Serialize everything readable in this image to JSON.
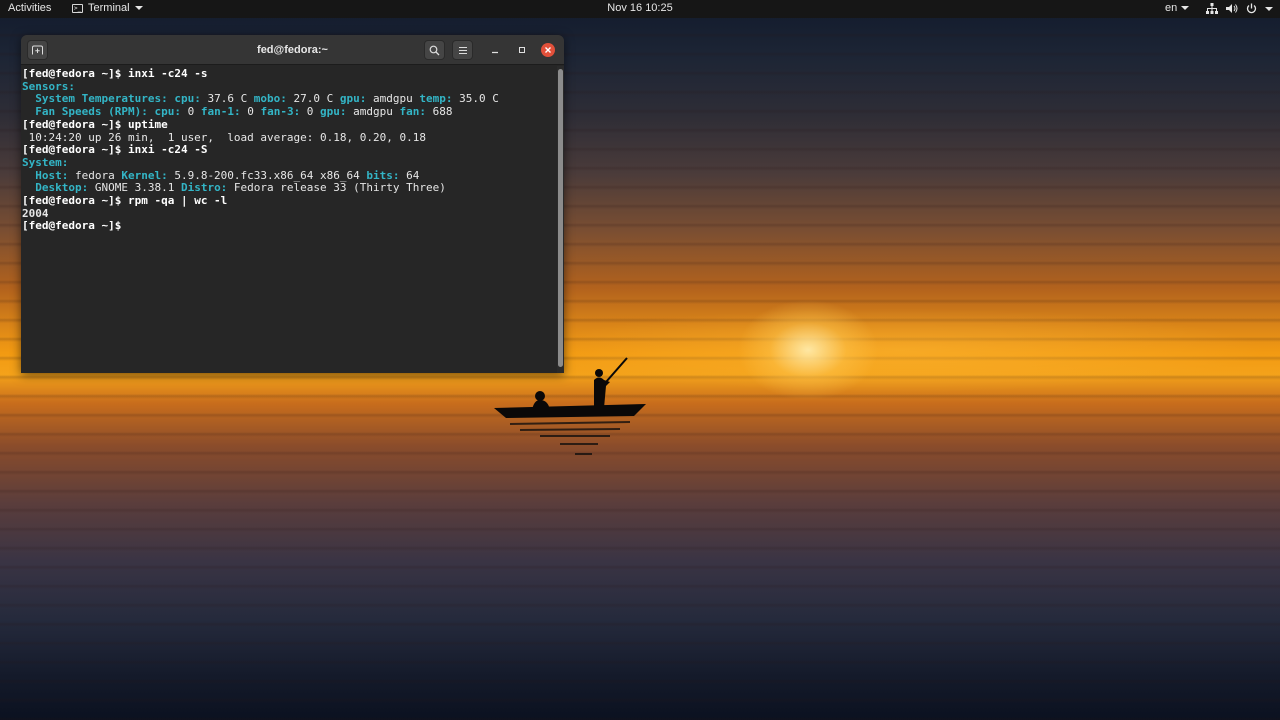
{
  "topbar": {
    "activities": "Activities",
    "app_name": "Terminal",
    "clock": "Nov 16  10:25",
    "lang": "en",
    "icons": [
      "network-icon",
      "volume-icon",
      "power-icon"
    ]
  },
  "window": {
    "title": "fed@fedora:~",
    "buttons": [
      "new-tab-icon",
      "search-icon",
      "menu-icon",
      "minimize-icon",
      "maximize-icon",
      "close-icon"
    ],
    "close_color": "#e2503a"
  },
  "terminal": {
    "prompt": "[fed@fedora ~]$",
    "cmd1": " inxi -c24 -s",
    "sensors_heading": "Sensors:",
    "temps_label": "  System Temperatures:",
    "cpu_label": " cpu:",
    "cpu_temp": " 37.6 C",
    "mobo_label": " mobo:",
    "mobo_temp": " 27.0 C",
    "gpu_label": " gpu:",
    "gpu_name": " amdgpu",
    "temp_label": " temp:",
    "gpu_temp": " 35.0 C",
    "fans_label": "  Fan Speeds (RPM):",
    "fan_cpu_label": " cpu:",
    "fan_cpu": " 0",
    "fan1_label": " fan-1:",
    "fan1": " 0",
    "fan3_label": " fan-3:",
    "fan3": " 0",
    "fan_gpu_label": " gpu:",
    "fan_gpu_name": " amdgpu",
    "fan_label": " fan:",
    "fan_gpu": " 688",
    "cmd2": " uptime",
    "uptime_output": " 10:24:20 up 26 min,  1 user,  load average: 0.18, 0.20, 0.18",
    "cmd3": " inxi -c24 -S",
    "system_heading": "System:",
    "host_label": "  Host:",
    "host": " fedora",
    "kernel_label": " Kernel:",
    "kernel": " 5.9.8-200.fc33.x86_64 x86_64",
    "bits_label": " bits:",
    "bits": " 64",
    "desktop_label": "  Desktop:",
    "desktop": " GNOME 3.38.1",
    "distro_label": " Distro:",
    "distro": " Fedora release 33 (Thirty Three)",
    "cmd4": " rpm -qa | wc -l",
    "rpm_count": "2004",
    "key_color": "#33b5c6"
  }
}
